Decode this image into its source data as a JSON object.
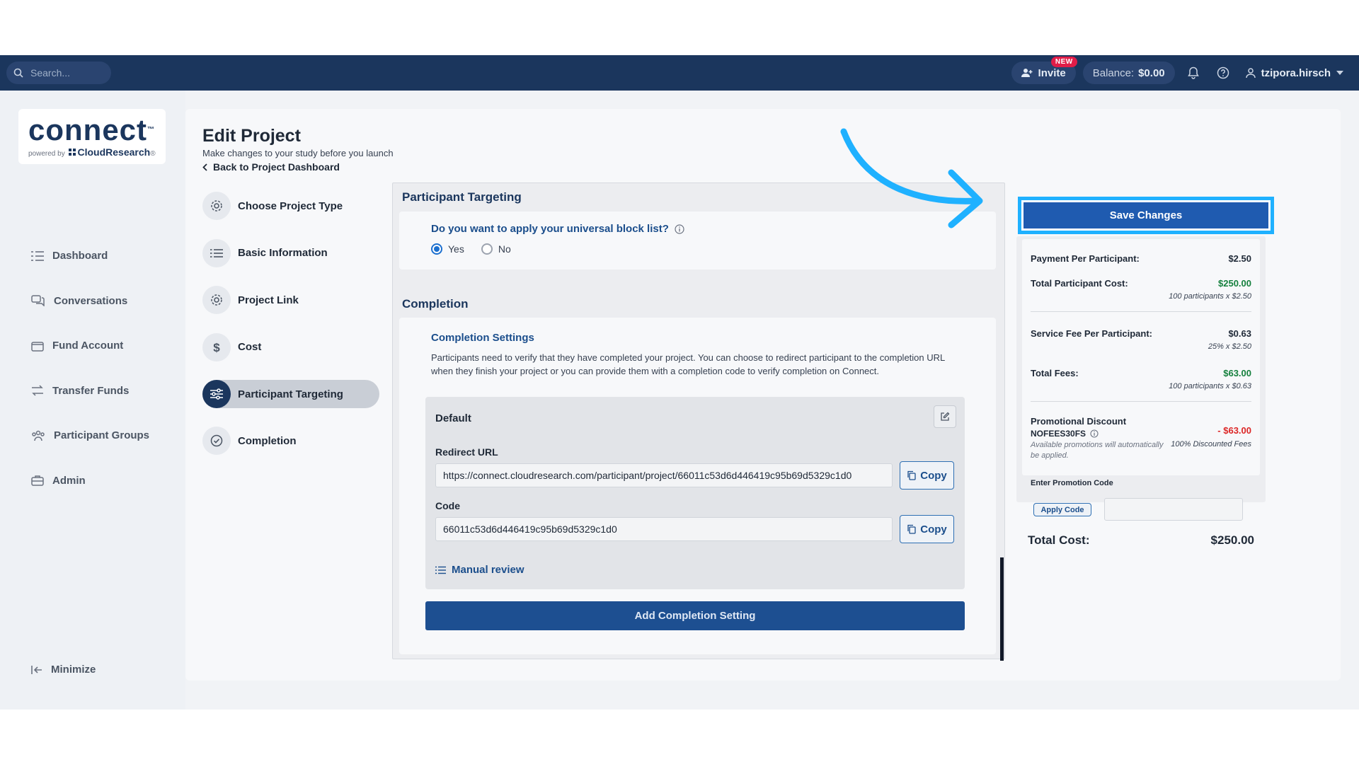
{
  "topbar": {
    "search_placeholder": "Search...",
    "invite_label": "Invite",
    "new_badge": "NEW",
    "balance_label": "Balance:",
    "balance_value": "$0.00",
    "username": "tzipora.hirsch"
  },
  "logo": {
    "word": "connect",
    "tm": "™",
    "powered_by": "powered by",
    "brand": "CloudResearch",
    "brand_mark": "®"
  },
  "sidebar": {
    "items": [
      {
        "label": "Dashboard",
        "icon": "list-icon"
      },
      {
        "label": "Conversations",
        "icon": "chat-icon"
      },
      {
        "label": "Fund Account",
        "icon": "wallet-icon"
      },
      {
        "label": "Transfer Funds",
        "icon": "transfer-icon"
      },
      {
        "label": "Participant Groups",
        "icon": "group-icon"
      },
      {
        "label": "Admin",
        "icon": "briefcase-icon"
      }
    ],
    "minimize_label": "Minimize"
  },
  "page": {
    "title": "Edit Project",
    "subtitle": "Make changes to your study before you launch",
    "back_link": "Back to Project Dashboard"
  },
  "steps": [
    {
      "label": "Choose Project Type",
      "icon": "gear-icon"
    },
    {
      "label": "Basic Information",
      "icon": "list-icon"
    },
    {
      "label": "Project Link",
      "icon": "gear-icon"
    },
    {
      "label": "Cost",
      "icon": "dollar-icon"
    },
    {
      "label": "Participant Targeting",
      "icon": "sliders-icon",
      "active": true
    },
    {
      "label": "Completion",
      "icon": "check-circle-icon"
    }
  ],
  "targeting": {
    "title": "Participant Targeting",
    "question": "Do you want to apply your universal block list?",
    "options": [
      "Yes",
      "No"
    ],
    "selected": "Yes"
  },
  "completion": {
    "title": "Completion",
    "settings_title": "Completion Settings",
    "description": "Participants need to verify that they have completed your project. You can choose to redirect participant to the completion URL when they finish your project or you can provide them with a completion code to verify completion on Connect.",
    "default_title": "Default",
    "redirect_label": "Redirect URL",
    "redirect_value": "https://connect.cloudresearch.com/participant/project/66011c53d6d446419c95b69d5329c1d0",
    "code_label": "Code",
    "code_value": "66011c53d6d446419c95b69d5329c1d0",
    "copy_label": "Copy",
    "manual_review": "Manual review",
    "add_button": "Add Completion Setting"
  },
  "summary": {
    "save_button": "Save Changes",
    "payment_label": "Payment Per Participant:",
    "payment_value": "$2.50",
    "total_participant_label": "Total Participant Cost:",
    "total_participant_value": "$250.00",
    "total_participant_note": "100 participants x $2.50",
    "service_fee_label": "Service Fee Per Participant:",
    "service_fee_value": "$0.63",
    "service_fee_note": "25% x $2.50",
    "total_fees_label": "Total Fees:",
    "total_fees_value": "$63.00",
    "total_fees_note": "100 participants x $0.63",
    "promo_label": "Promotional Discount",
    "promo_code": "NOFEES30FS",
    "promo_value": "- $63.00",
    "promo_value_note": "100% Discounted Fees",
    "promo_auto_note": "Available promotions will automatically be applied.",
    "enter_promo_label": "Enter Promotion Code",
    "apply_code": "Apply Code",
    "total_cost_label": "Total Cost:",
    "total_cost_value": "$250.00"
  },
  "colors": {
    "topbar": "#1b365d",
    "accent_blue": "#1f5bb0",
    "highlight_cyan": "#1fb1ff",
    "green": "#15803d",
    "red": "#dc2626"
  }
}
